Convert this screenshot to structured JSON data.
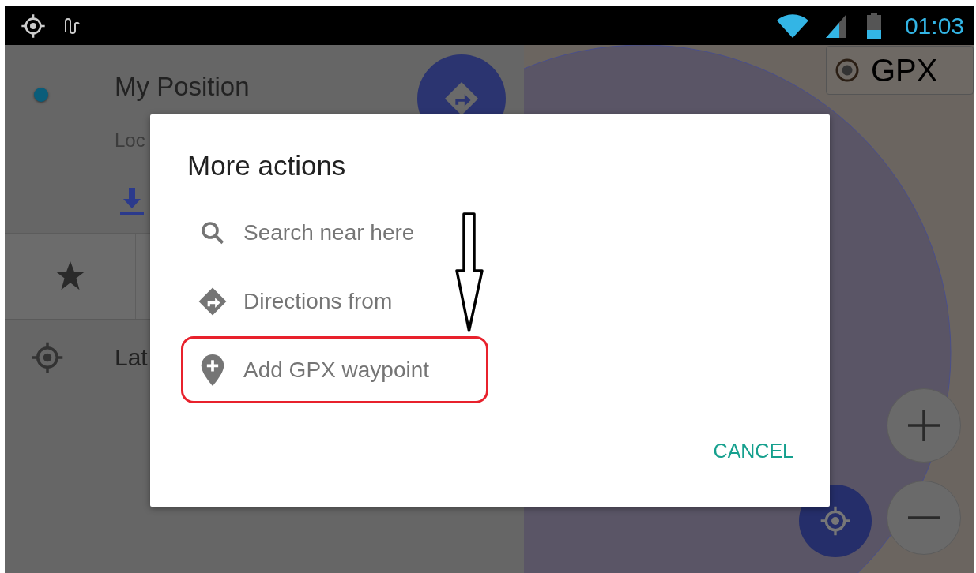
{
  "status_bar": {
    "time": "01:03"
  },
  "place_panel": {
    "title": "My Position",
    "subtitle": "Loc",
    "coordinates_label": "Lat"
  },
  "map": {
    "layer_button": {
      "label": "GPX",
      "selected": true
    }
  },
  "dialog": {
    "title": "More actions",
    "items": [
      {
        "kind": "search",
        "label": "Search near here",
        "highlighted": false
      },
      {
        "kind": "directions",
        "label": "Directions from",
        "highlighted": false
      },
      {
        "kind": "waypoint",
        "label": "Add GPX waypoint",
        "highlighted": true
      }
    ],
    "cancel": "CANCEL"
  }
}
